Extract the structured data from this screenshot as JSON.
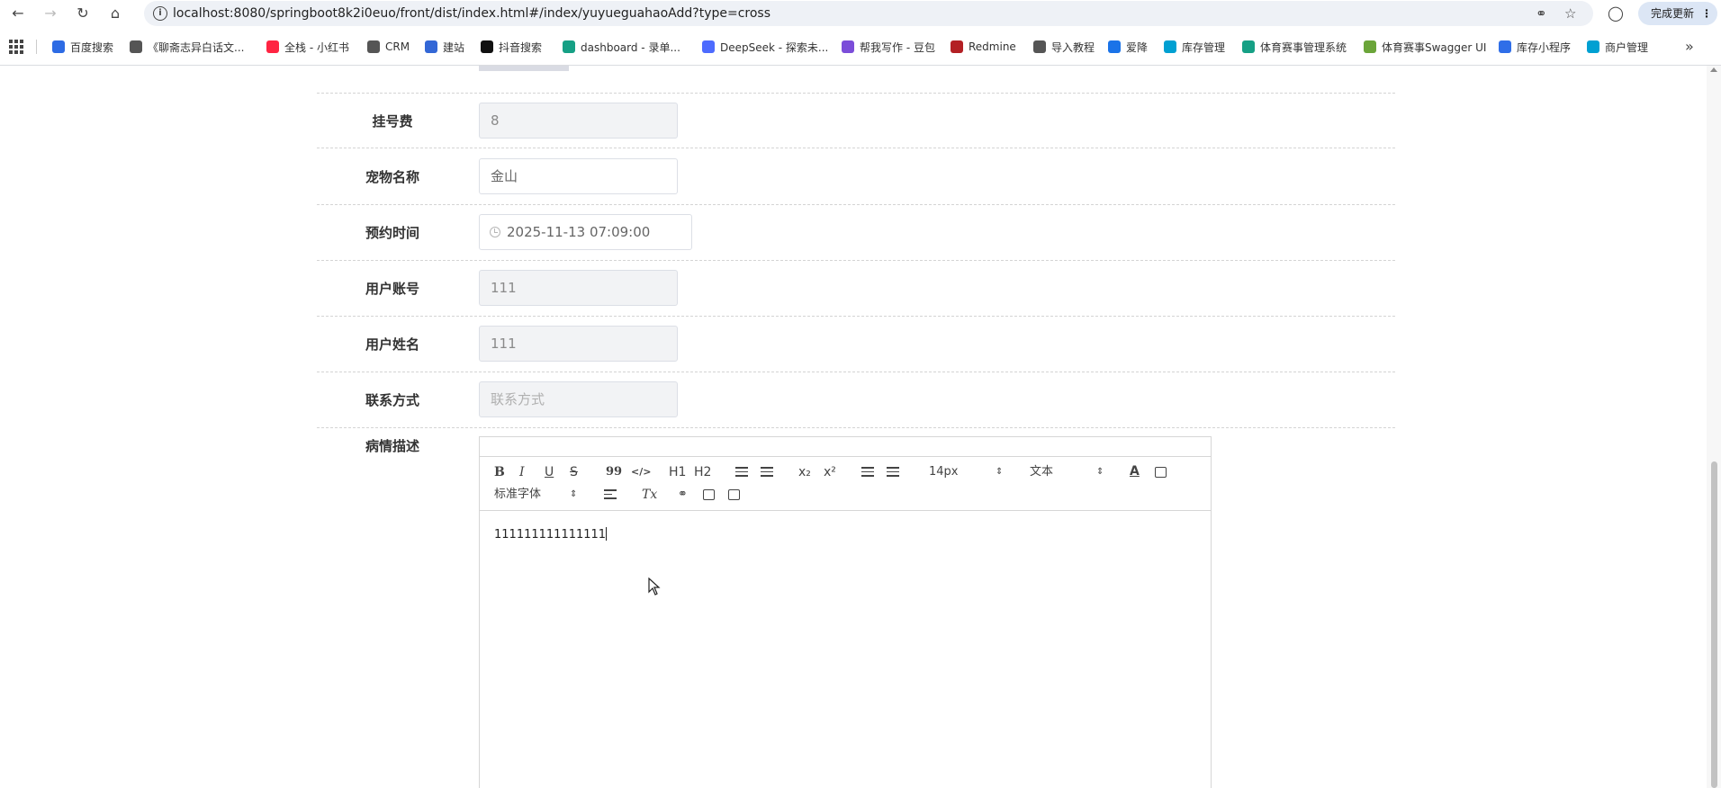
{
  "browser": {
    "url": "localhost:8080/springboot8k2i0euo/front/dist/index.html#/index/yuyueguahaoAdd?type=cross",
    "update_label": "完成更新",
    "bookmarks": [
      {
        "label": "百度搜索",
        "color": "#2d6be4"
      },
      {
        "label": "《聊斋志异白话文...",
        "color": "#555555"
      },
      {
        "label": "全栈 - 小红书",
        "color": "#ff2442"
      },
      {
        "label": "CRM",
        "color": "#555555"
      },
      {
        "label": "建站",
        "color": "#3367d6"
      },
      {
        "label": "抖音搜索",
        "color": "#111111"
      },
      {
        "label": "dashboard - 录单...",
        "color": "#16a085"
      },
      {
        "label": "DeepSeek - 探索未...",
        "color": "#4d6bfe"
      },
      {
        "label": "帮我写作 - 豆包",
        "color": "#7b4dd9"
      },
      {
        "label": "Redmine",
        "color": "#b32024"
      },
      {
        "label": "导入教程",
        "color": "#555555"
      },
      {
        "label": "爱降",
        "color": "#1a73e8"
      },
      {
        "label": "库存管理",
        "color": "#00a0d2"
      },
      {
        "label": "体育赛事管理系统",
        "color": "#16a085"
      },
      {
        "label": "体育赛事Swagger UI",
        "color": "#6ba539"
      },
      {
        "label": "库存小程序",
        "color": "#2f6ee8"
      },
      {
        "label": "商户管理",
        "color": "#00a0d2"
      }
    ]
  },
  "form": {
    "fee": {
      "label": "挂号费",
      "value": "8"
    },
    "pet_name": {
      "label": "宠物名称",
      "value": "金山"
    },
    "appointment_time": {
      "label": "预约时间",
      "value": "2025-11-13 07:09:00"
    },
    "user_account": {
      "label": "用户账号",
      "value": "111"
    },
    "user_name": {
      "label": "用户姓名",
      "value": "111"
    },
    "contact": {
      "label": "联系方式",
      "placeholder": "联系方式"
    },
    "description": {
      "label": "病情描述",
      "content": "111111111111111",
      "toolbar": {
        "bold": "B",
        "italic": "I",
        "underline": "U",
        "strike": "S",
        "blockquote": "99",
        "code": "</>",
        "h1": "H1",
        "h2": "H2",
        "subscript": "x₂",
        "superscript": "x²",
        "size": "14px",
        "header": "文本",
        "font": "标准字体",
        "clean": "Tx"
      }
    }
  }
}
